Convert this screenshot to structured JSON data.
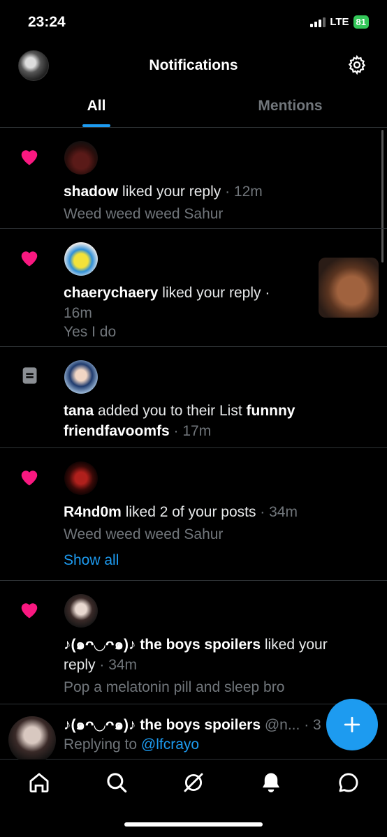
{
  "status_bar": {
    "time": "23:24",
    "network": "LTE",
    "battery": "81"
  },
  "header": {
    "title": "Notifications"
  },
  "tabs": [
    {
      "label": "All",
      "active": true
    },
    {
      "label": "Mentions",
      "active": false
    }
  ],
  "notifications": [
    {
      "type": "like",
      "user": "shadow",
      "action": " liked your reply",
      "time": " · 12m",
      "preview": "Weed weed weed Sahur"
    },
    {
      "type": "like",
      "user": "chaerychaery",
      "action": " liked your reply ·",
      "time": "16m",
      "preview": "Yes I do"
    },
    {
      "type": "list",
      "user": "tana",
      "action": " added you to their List ",
      "list_name_1": "funnny",
      "list_name_2": "friendfavoomfs",
      "time": " · 17m"
    },
    {
      "type": "like",
      "user": "R4nd0m",
      "action": " liked 2 of your posts",
      "time": " · 34m",
      "preview": "Weed weed weed Sahur",
      "show_all": "Show all"
    },
    {
      "type": "like",
      "user": "♪(๑ᴖ◡ᴖ๑)♪ the boys spoilers",
      "action": " liked your",
      "action_2": "reply",
      "time": " · 34m",
      "preview": "Pop a melatonin pill and sleep bro"
    }
  ],
  "reply": {
    "user": "♪(๑ᴖ◡ᴖ๑)♪ the boys spoilers",
    "handle": " @n...",
    "time": " · 3",
    "replying_prefix": "Replying to ",
    "replying_handle": "@lfcrayo"
  },
  "colors": {
    "accent": "#1d9bf0",
    "like": "#f91880",
    "muted": "#71767b"
  },
  "icons": {
    "header": [
      "avatar",
      "gear-icon"
    ],
    "nav": [
      "home-icon",
      "search-icon",
      "grok-icon",
      "bell-icon",
      "messages-icon"
    ],
    "fab": "plus-icon"
  }
}
